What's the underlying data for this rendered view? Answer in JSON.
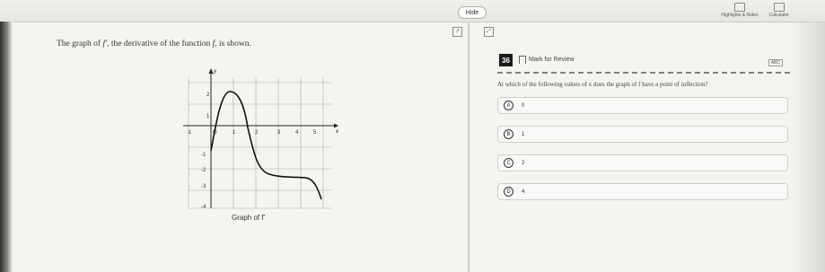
{
  "toolbar": {
    "hide_label": "Hide",
    "highlights_label": "Highlights & Notes",
    "calculator_label": "Calculator"
  },
  "question": {
    "stem_prefix": "The graph of ",
    "stem_func": "f′",
    "stem_mid": ", the derivative of the function ",
    "stem_f": "f",
    "stem_suffix": ", is shown.",
    "graph_caption": "Graph of f′"
  },
  "graph": {
    "axis_x_label": "x",
    "axis_y_label": "y",
    "x_ticks": [
      "-1",
      "O",
      "1",
      "2",
      "3",
      "4",
      "5"
    ],
    "y_ticks": [
      "2",
      "1",
      "-1",
      "-2",
      "-3",
      "-4"
    ]
  },
  "panel": {
    "number": "36",
    "mark_label": "Mark for Review",
    "prompt": "At which of the following values of x does the graph of f have a point of inflection?",
    "choices": [
      {
        "letter": "A",
        "value": "0"
      },
      {
        "letter": "B",
        "value": "1"
      },
      {
        "letter": "C",
        "value": "2"
      },
      {
        "letter": "D",
        "value": "4"
      }
    ]
  }
}
